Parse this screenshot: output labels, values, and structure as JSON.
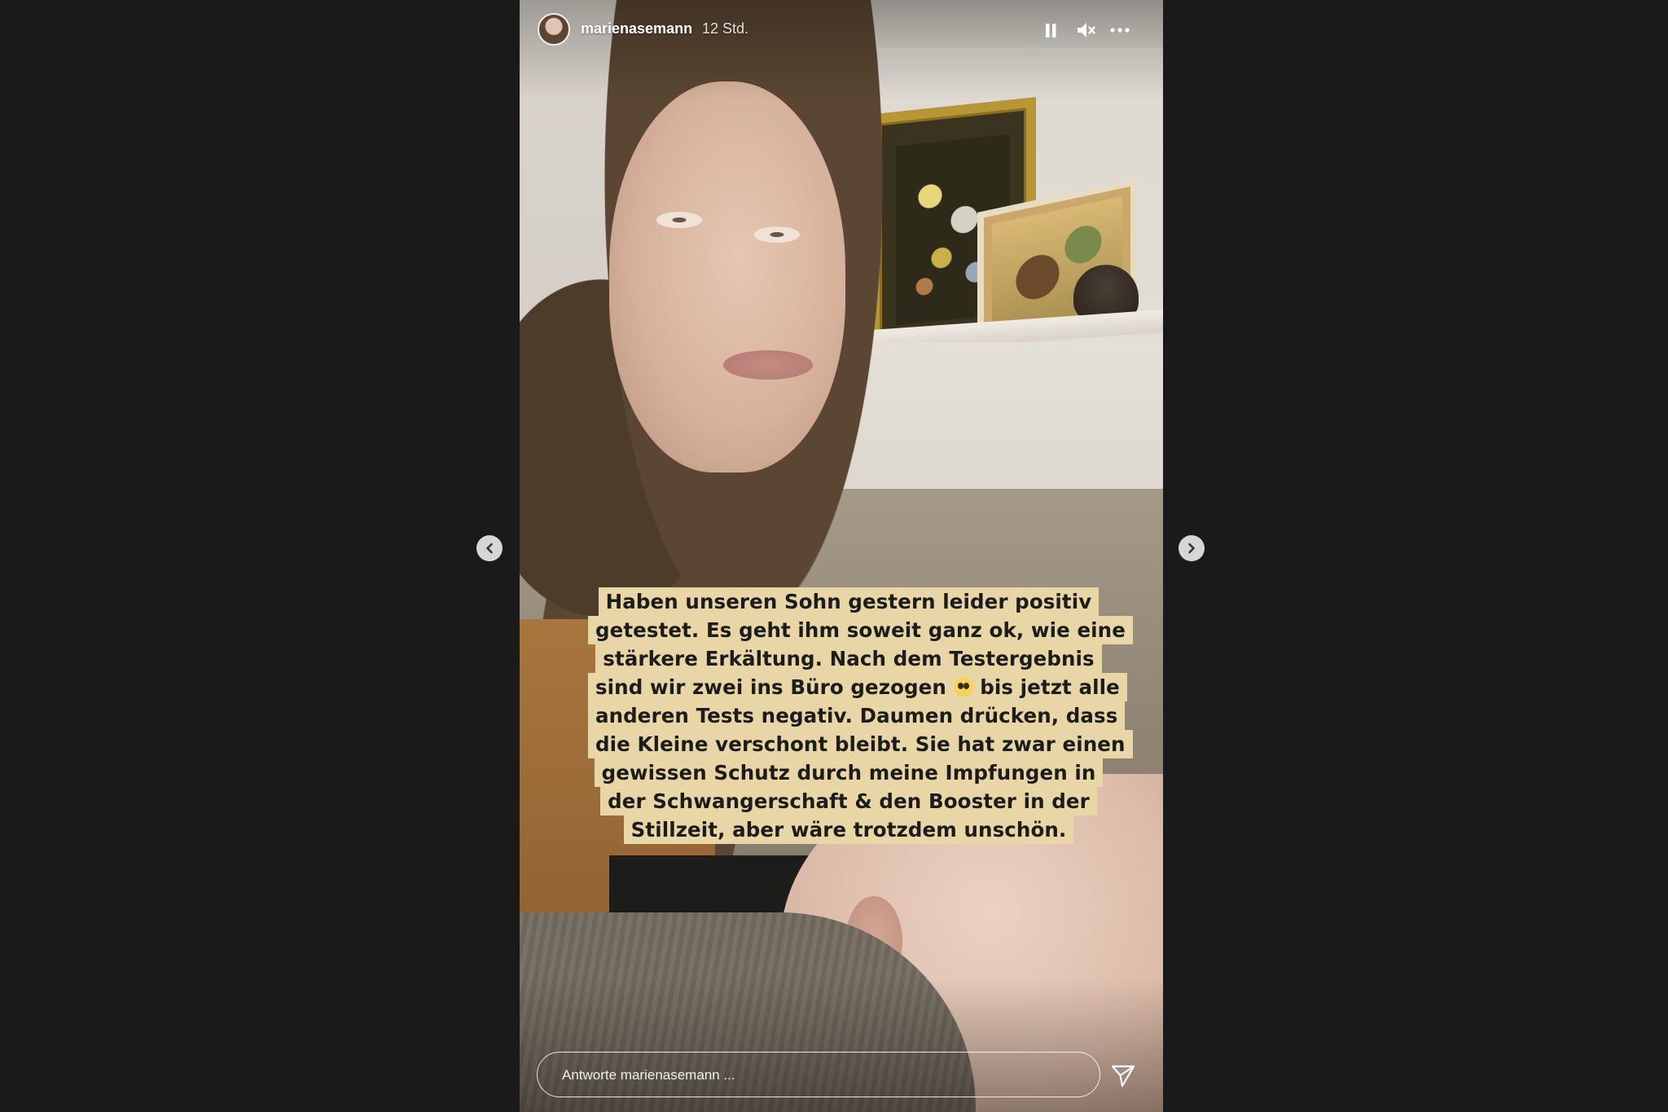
{
  "story": {
    "username": "marienasemann",
    "timestamp": "12 Std.",
    "header_icons": [
      "pause-icon",
      "mute-icon",
      "more-icon"
    ],
    "caption_lines": [
      "Haben unseren Sohn gestern leider positiv",
      "getestet. Es geht ihm soweit ganz ok, wie eine",
      "stärkere Erkältung. Nach dem Testergebnis",
      "sind wir zwei ins Büro gezogen",
      "bis jetzt alle",
      "anderen Tests negativ. Daumen drücken, dass",
      "die Kleine verschont bleibt. Sie hat zwar einen",
      "gewissen Schutz durch meine Impfungen in",
      "der Schwangerschaft & den Booster in der",
      "Stillzeit, aber wäre trotzdem unschön."
    ],
    "caption_emoji": "pleading-face-icon",
    "caption_color": "#e9d6a6"
  },
  "navigation": {
    "prev_icon": "chevron-left-icon",
    "next_icon": "chevron-right-icon"
  },
  "reply": {
    "placeholder": "Antworte marienasemann ...",
    "value": "",
    "send_icon": "send-icon"
  },
  "colors": {
    "background": "#1a1a1a",
    "text": "#ffffff"
  }
}
